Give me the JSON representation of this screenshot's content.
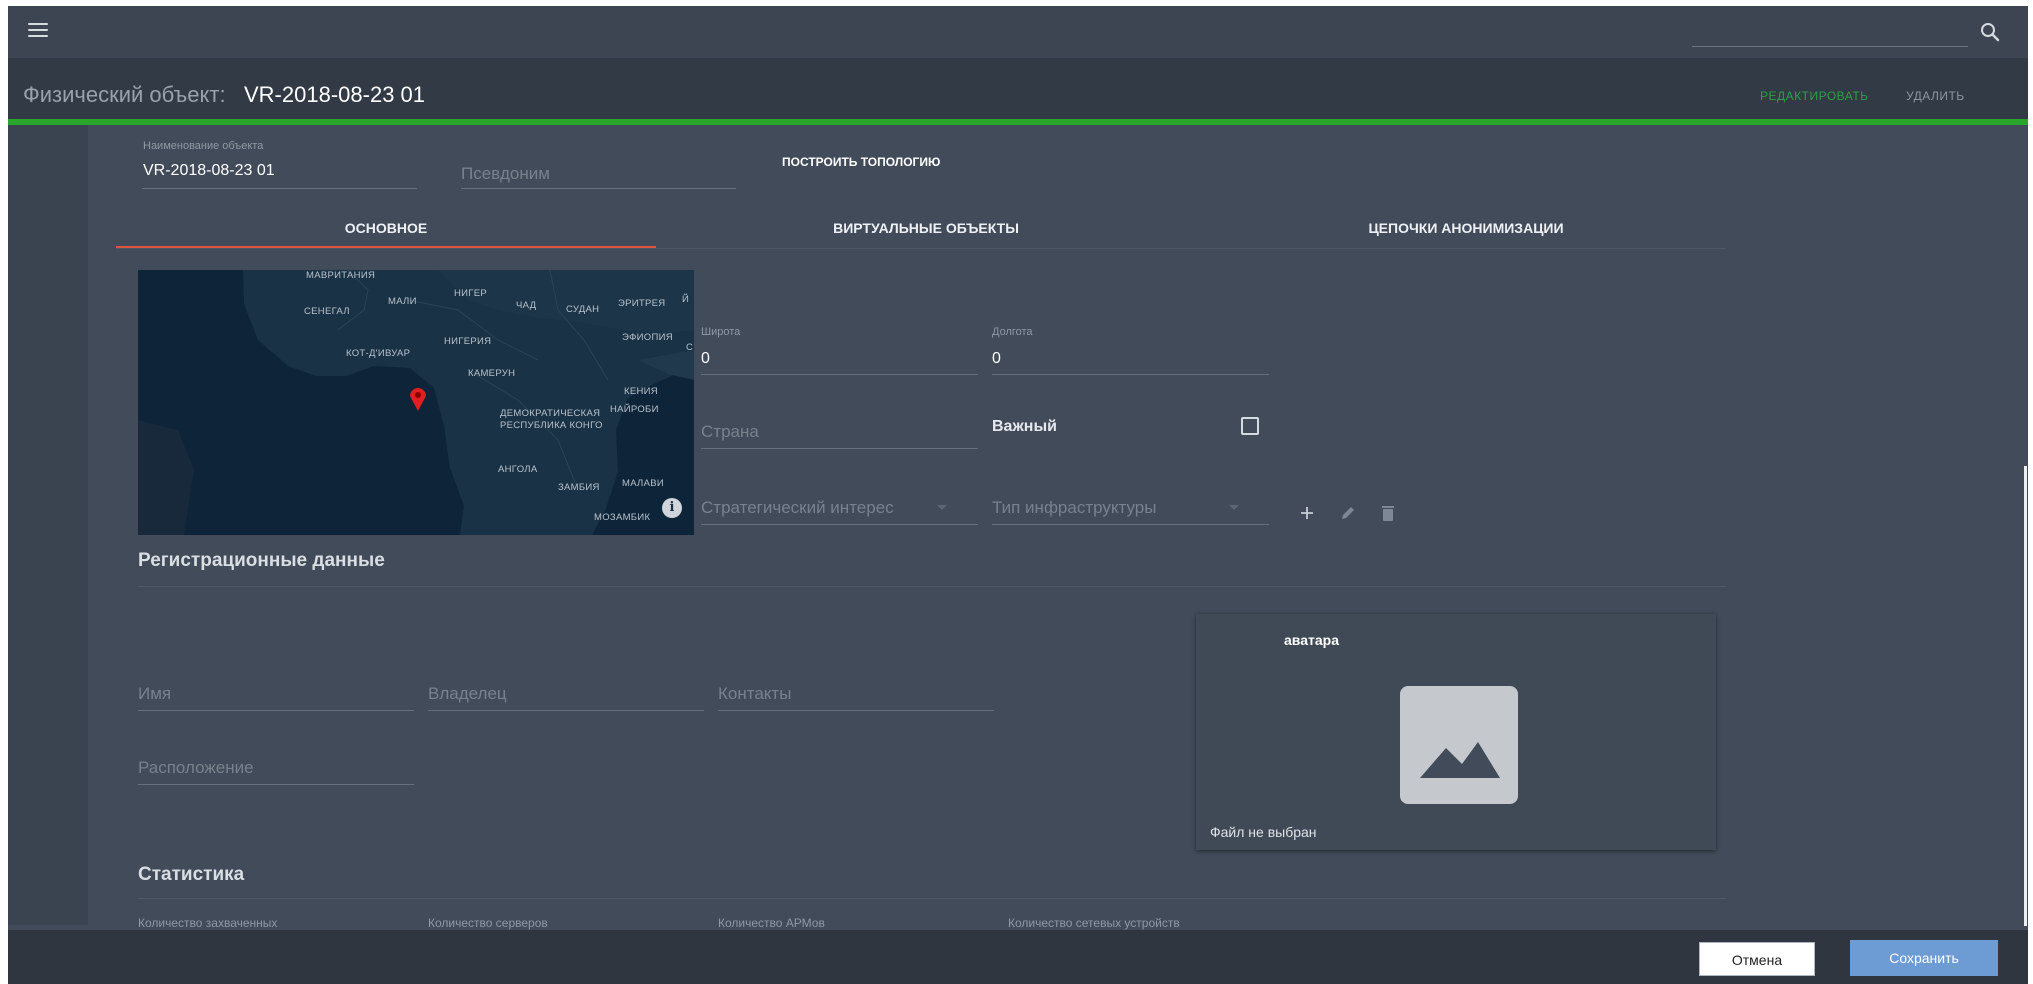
{
  "header": {
    "menu_icon": "menu-icon",
    "search_icon": "search-icon"
  },
  "title": {
    "label": "Физический объект:",
    "value": "VR-2018-08-23 01",
    "edit_label": "РЕДАКТИРОВАТЬ",
    "delete_label": "УДАЛИТЬ"
  },
  "object": {
    "name_label": "Наименование объекта",
    "name_value": "VR-2018-08-23 01",
    "alias_placeholder": "Псевдоним",
    "topology_button": "ПОСТРОИТЬ ТОПОЛОГИЮ"
  },
  "tabs": [
    {
      "label": "ОСНОВНОЕ",
      "active": true
    },
    {
      "label": "ВИРТУАЛЬНЫЕ ОБЪЕКТЫ",
      "active": false
    },
    {
      "label": "ЦЕПОЧКИ АНОНИМИЗАЦИИ",
      "active": false
    }
  ],
  "map": {
    "labels": [
      "МАВРИТАНИЯ",
      "МАЛИ",
      "НИГЕР",
      "ЧАД",
      "СУДАН",
      "ЭРИТРЕЯ",
      "Й",
      "СЕНЕГАЛ",
      "НИГЕРИЯ",
      "ЭФИОПИЯ",
      "С",
      "КОТ-Д'ИВУАР",
      "КАМЕРУН",
      "КЕНИЯ",
      "ДЕМОКРАТИЧЕСКАЯ",
      "НАЙРОБИ",
      "РЕСПУБЛИКА КОНГО",
      "АНГОЛА",
      "МАЛАВИ",
      "ЗАМБИЯ",
      "МОЗАМБИК"
    ],
    "marker_icon": "map-pin-icon",
    "info_icon": "info-icon"
  },
  "geo": {
    "lat_label": "Широта",
    "lat_value": "0",
    "lon_label": "Долгота",
    "lon_value": "0",
    "country_placeholder": "Страна",
    "important_label": "Важный",
    "important_checked": false,
    "strategic_placeholder": "Стратегический интерес",
    "infra_placeholder": "Тип инфраструктуры"
  },
  "registration": {
    "title": "Регистрационные данные",
    "name_placeholder": "Имя",
    "owner_placeholder": "Владелец",
    "contacts_placeholder": "Контакты",
    "location_placeholder": "Расположение"
  },
  "avatar": {
    "title": "аватара",
    "status": "Файл не выбран"
  },
  "statistics": {
    "title": "Статистика",
    "labels": [
      "Количество захваченных",
      "Количество серверов",
      "Количество АРМов",
      "Количество сетевых устройств"
    ]
  },
  "footer": {
    "cancel_label": "Отмена",
    "save_label": "Сохранить"
  },
  "colors": {
    "accent_green": "#2aa52c",
    "active_tab_underline": "#e0533d",
    "save_button": "#6d9bd3",
    "background": "#414b59"
  }
}
